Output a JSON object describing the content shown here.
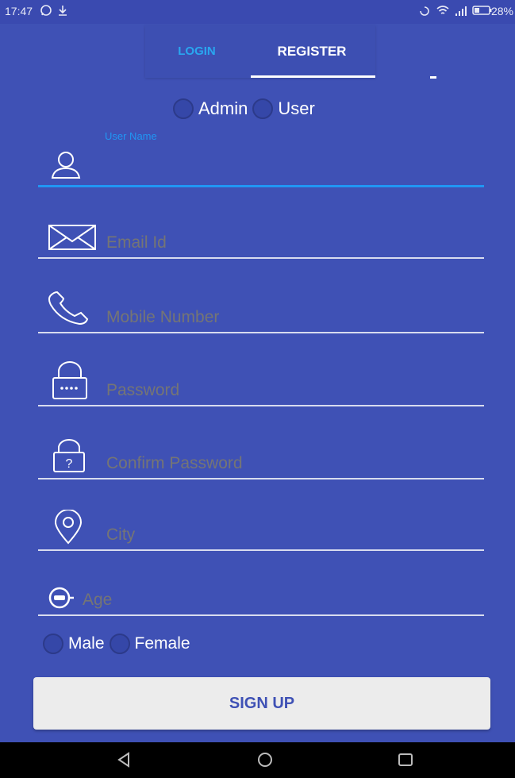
{
  "status_bar": {
    "time": "17:47",
    "battery": "28%",
    "icons": [
      "whatsapp-icon",
      "download-icon",
      "alarm-icon",
      "wifi-icon",
      "signal-icon",
      "battery-icon"
    ]
  },
  "tabs": [
    {
      "label": "LOGIN",
      "active": false
    },
    {
      "label": "REGISTER",
      "active": true
    }
  ],
  "role": {
    "options": [
      "Admin",
      "User"
    ],
    "selected": null
  },
  "fields": {
    "username": {
      "label": "User Name",
      "value": "",
      "placeholder": "",
      "icon": "user-icon"
    },
    "email": {
      "placeholder": "Email Id",
      "value": "",
      "icon": "envelope-icon"
    },
    "mobile": {
      "placeholder": "Mobile Number",
      "value": "",
      "icon": "phone-icon"
    },
    "password": {
      "placeholder": "Password",
      "value": "",
      "icon": "lock-icon"
    },
    "confirm_password": {
      "placeholder": "Confirm Password",
      "value": "",
      "icon": "lock-question-icon"
    },
    "city": {
      "placeholder": "City",
      "value": "",
      "icon": "location-pin-icon"
    },
    "age": {
      "placeholder": "Age",
      "value": "",
      "icon": "age-icon"
    }
  },
  "gender": {
    "options": [
      "Male",
      "Female"
    ],
    "selected": null
  },
  "signup_label": "SIGN UP",
  "colors": {
    "background": "#3f51b5",
    "accent": "#2196f3",
    "tab_inactive": "#29a7f0",
    "button_bg": "#ececec"
  }
}
